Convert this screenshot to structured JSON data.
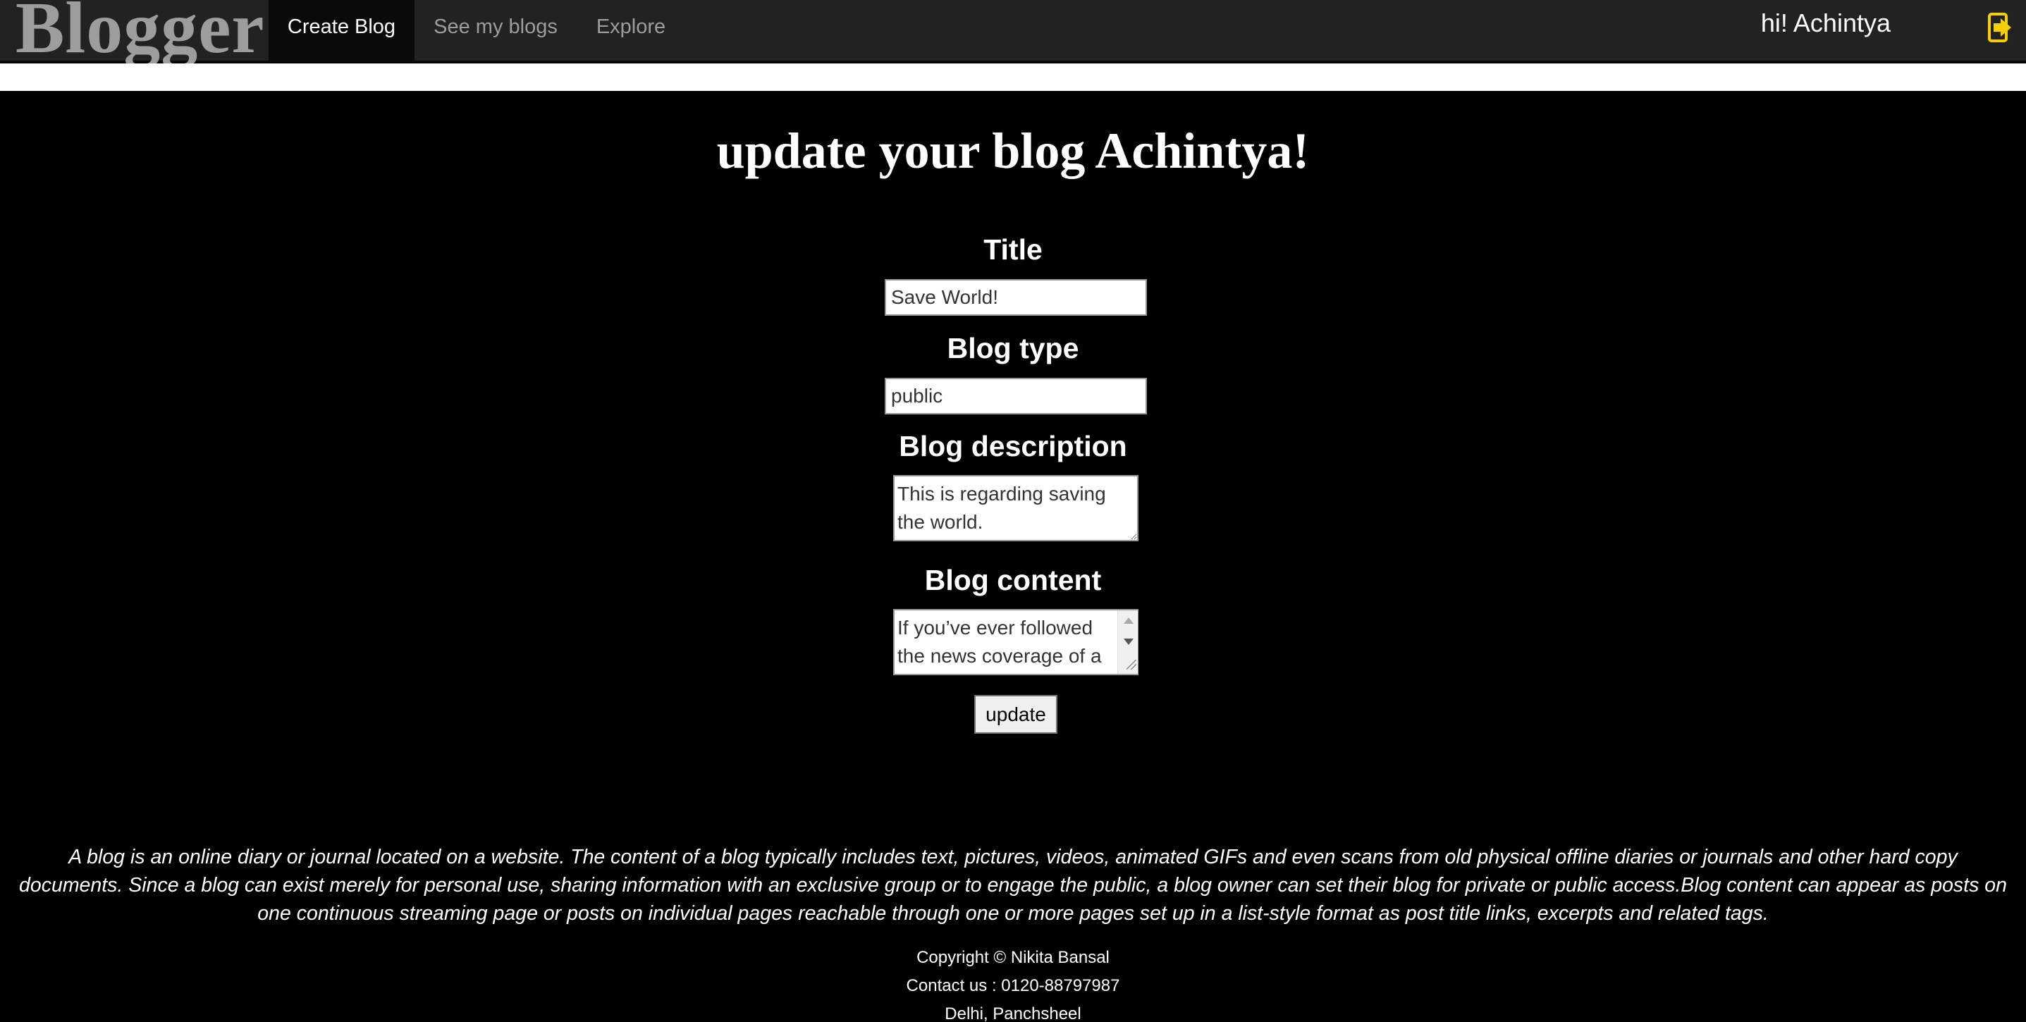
{
  "navbar": {
    "brand": "Blogger",
    "items": [
      {
        "label": "Create Blog",
        "active": true
      },
      {
        "label": "See my blogs",
        "active": false
      },
      {
        "label": "Explore",
        "active": false
      }
    ],
    "greeting": "hi! Achintya",
    "logout_icon": "sign-out-icon",
    "logout_icon_color": "#f5d000"
  },
  "form": {
    "heading": "update your blog Achintya!",
    "title_label": "Title",
    "title_value": "Save World!",
    "type_label": "Blog type",
    "type_value": "public",
    "description_label": "Blog description",
    "description_value": "This is regarding saving the world.",
    "content_label": "Blog content",
    "content_value": "If you’ve ever followed the news coverage of a",
    "submit_label": "update"
  },
  "footer": {
    "description": "A blog is an online diary or journal located on a website. The content of a blog typically includes text, pictures, videos, animated GIFs and even scans from old physical offline diaries or journals and other hard copy documents. Since a blog can exist merely for personal use, sharing information with an exclusive group or to engage the public, a blog owner can set their blog for private or public access.Blog content can appear as posts on one continuous streaming page or posts on individual pages reachable through one or more pages set up in a list-style format as post title links, excerpts and related tags.",
    "copyright": "Copyright © Nikita Bansal",
    "contact": "Contact us : 0120-88797987",
    "address": "Delhi, Panchsheel"
  },
  "colors": {
    "navbar_bg": "#222222",
    "page_bg": "#000000",
    "accent": "#f5d000"
  }
}
